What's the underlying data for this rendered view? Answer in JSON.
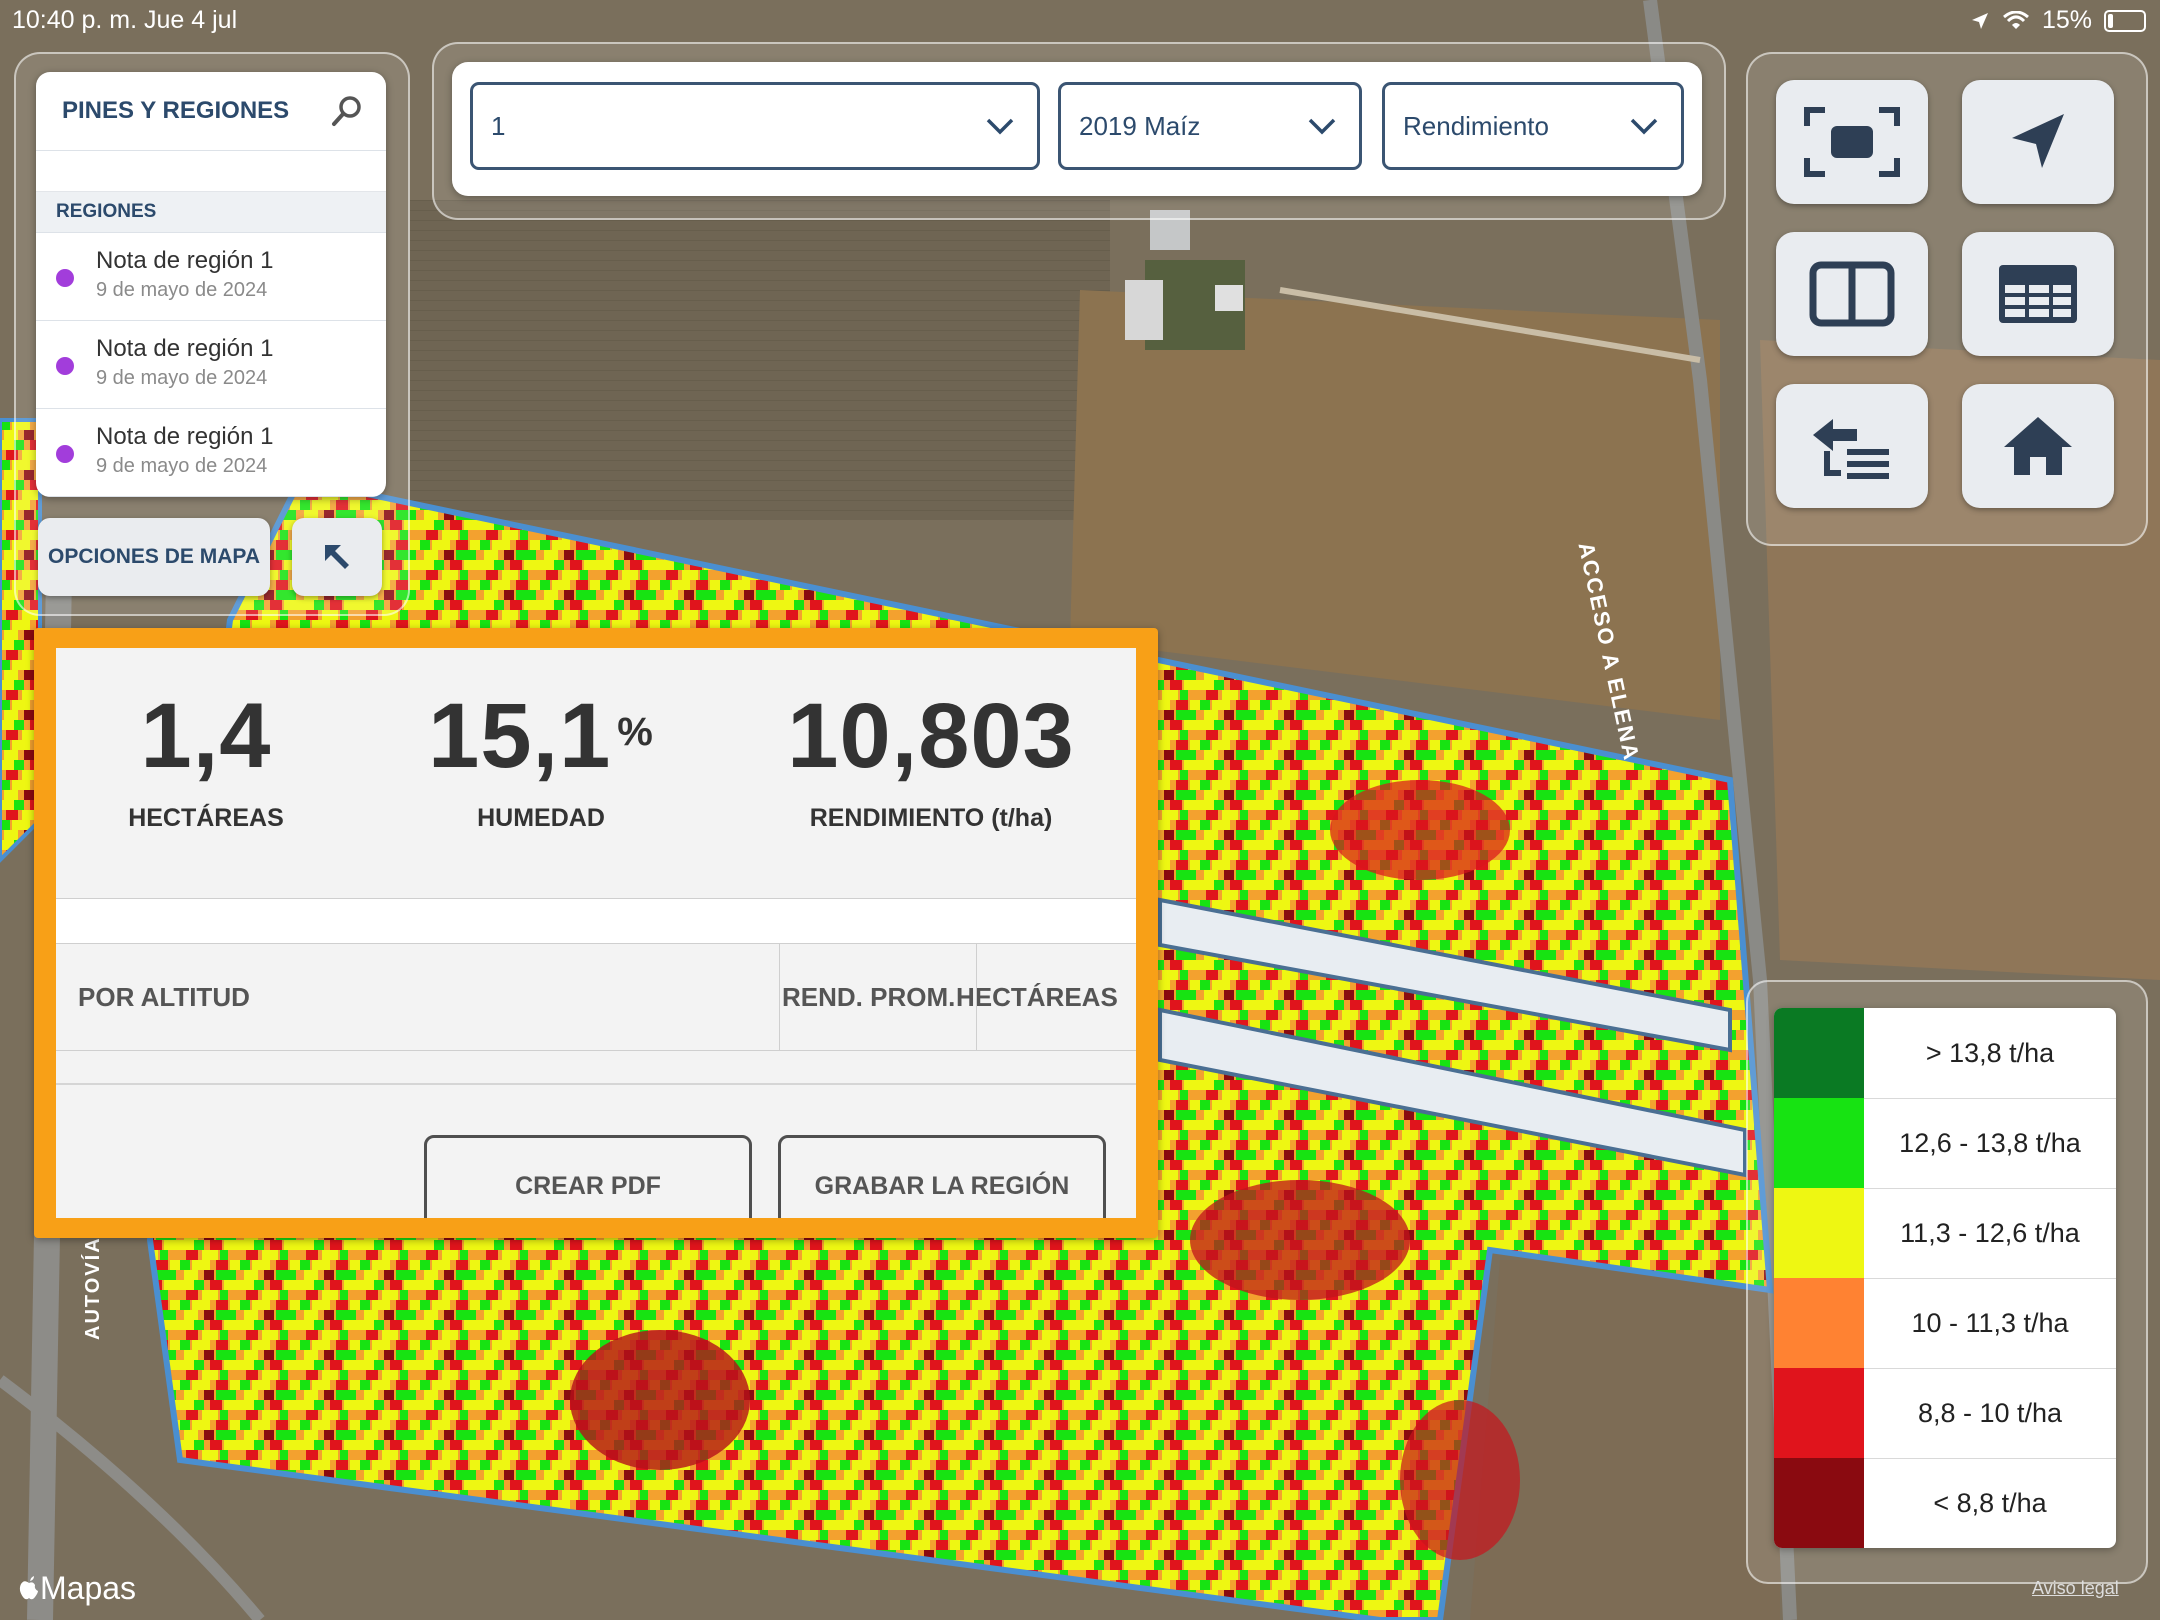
{
  "status_bar": {
    "time": "10:40 p. m.   Jue 4 jul",
    "battery": "15%"
  },
  "pins_panel": {
    "title": "PINES Y REGIONES",
    "section": "REGIONES",
    "regions": [
      {
        "title": "Nota de región 1",
        "date": "9 de mayo de 2024"
      },
      {
        "title": "Nota de región 1",
        "date": "9 de mayo de 2024"
      },
      {
        "title": "Nota de región 1",
        "date": "9 de mayo de 2024"
      }
    ]
  },
  "map_options": {
    "label": "OPCIONES DE MAPA"
  },
  "selectors": [
    {
      "value": "1"
    },
    {
      "value": "2019 Maíz"
    },
    {
      "value": "Rendimiento"
    }
  ],
  "tools": [
    "fit-screen-icon",
    "location-arrow-icon",
    "split-view-icon",
    "table-icon",
    "export-list-icon",
    "home-icon"
  ],
  "stats": {
    "area": {
      "value": "1,4",
      "label": "HECTÁREAS"
    },
    "humidity": {
      "value": "15,1",
      "unit": "%",
      "label": "HUMEDAD"
    },
    "yield": {
      "value": "10,803",
      "label": "RENDIMIENTO (t/ha)"
    },
    "table_headers": {
      "col1": "POR ALTITUD",
      "col2": "REND. PROM.",
      "col3": "HECTÁREAS"
    },
    "buttons": {
      "pdf": "CREAR PDF",
      "save": "GRABAR LA REGIÓN"
    }
  },
  "legend": [
    {
      "label": "> 13,8 t/ha",
      "color": "#0a7a23"
    },
    {
      "label": "12,6 - 13,8 t/ha",
      "color": "#17e312"
    },
    {
      "label": "11,3 - 12,6 t/ha",
      "color": "#eef712"
    },
    {
      "label": "10 - 11,3 t/ha",
      "color": "#ff8232"
    },
    {
      "label": "8,8 - 10 t/ha",
      "color": "#e0141c"
    },
    {
      "label": "< 8,8 t/ha",
      "color": "#8a0a10"
    }
  ],
  "map_labels": {
    "road1": "ACCESO A ELENA",
    "road2": "AUTOVÍA",
    "attribution": "Mapas",
    "legal": "Aviso legal"
  }
}
